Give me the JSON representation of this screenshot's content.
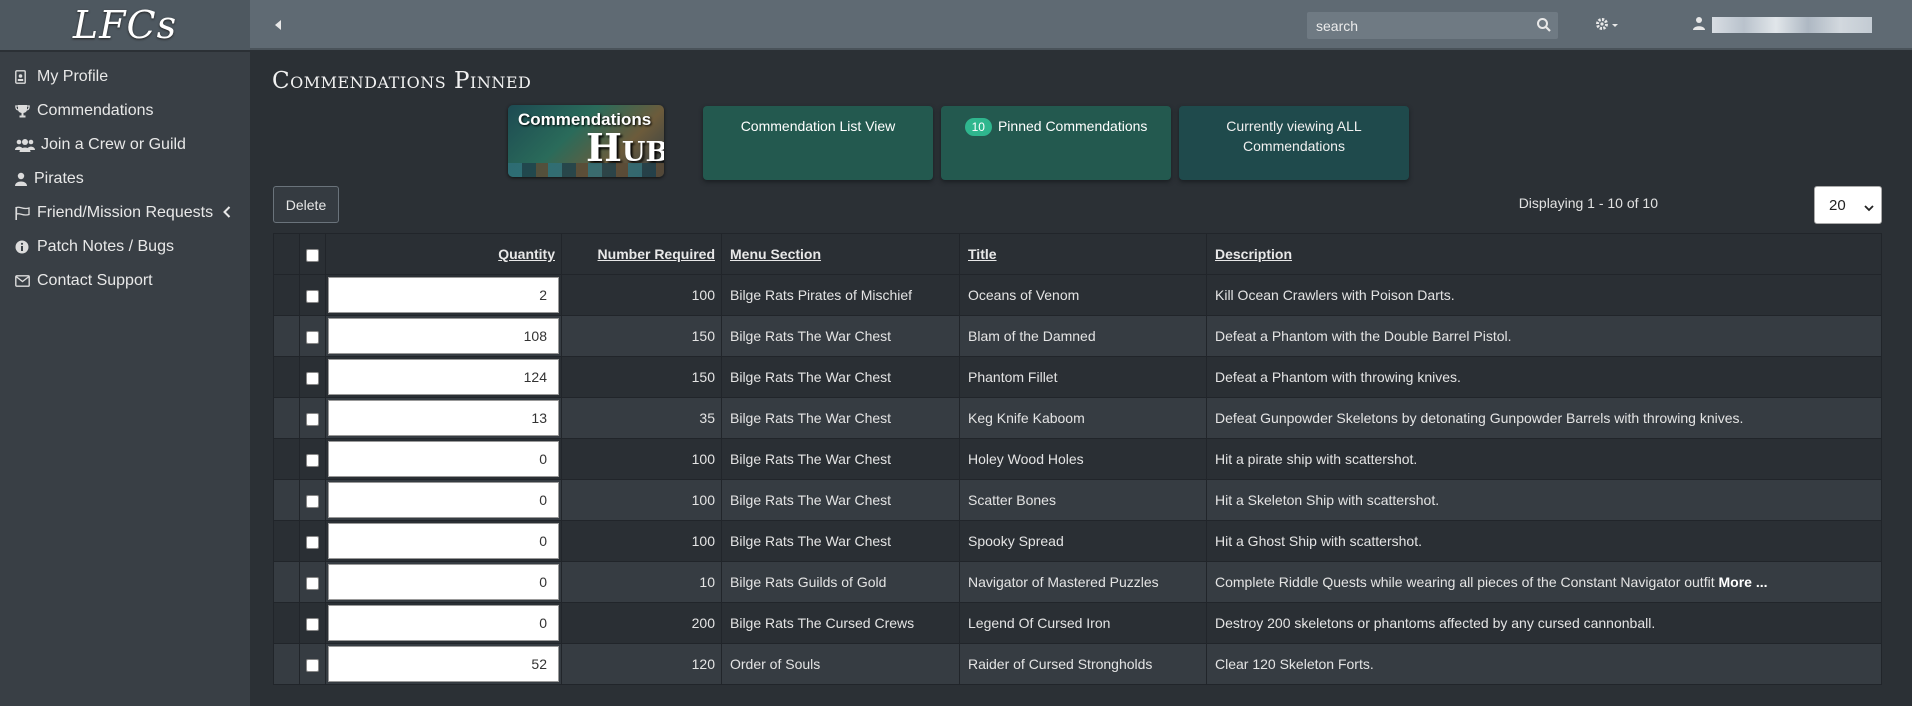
{
  "brand": {
    "logo": "LFCs"
  },
  "topbar": {
    "search_placeholder": "search",
    "collapse_icon": "chevron-left-icon",
    "search_icon": "search-icon",
    "settings_icon": "gear-icon",
    "user_icon": "user-icon"
  },
  "sidebar": {
    "items": [
      {
        "label": "My Profile",
        "icon": "id-badge-icon"
      },
      {
        "label": "Commendations",
        "icon": "trophy-icon"
      },
      {
        "label": "Join a Crew or Guild",
        "icon": "users-icon"
      },
      {
        "label": "Pirates",
        "icon": "user-icon"
      },
      {
        "label": "Friend/Mission Requests",
        "icon": "flag-icon"
      },
      {
        "label": "Patch Notes / Bugs",
        "icon": "info-circle-icon"
      },
      {
        "label": "Contact Support",
        "icon": "envelope-icon"
      }
    ]
  },
  "main": {
    "title": "Commendations Pinned",
    "hub": {
      "top": "Commendations",
      "big": "Hub"
    },
    "tiles": {
      "list_view": "Commendation List View",
      "pinned_count": "10",
      "pinned_label": "Pinned Commendations",
      "viewing_line1": "Currently viewing ALL",
      "viewing_line2": "Commendations"
    },
    "delete_label": "Delete",
    "displaying": "Displaying 1 - 10 of 10",
    "page_size": "20"
  },
  "table": {
    "headers": {
      "quantity": "Quantity",
      "required": "Number Required",
      "section": "Menu Section",
      "title": "Title",
      "description": "Description"
    },
    "more_label": "More ...",
    "rows": [
      {
        "qty": "2",
        "req": "100",
        "section": "Bilge Rats Pirates of Mischief",
        "title": "Oceans of Venom",
        "desc": "Kill Ocean Crawlers with Poison Darts."
      },
      {
        "qty": "108",
        "req": "150",
        "section": "Bilge Rats The War Chest",
        "title": "Blam of the Damned",
        "desc": "Defeat a Phantom with the Double Barrel Pistol."
      },
      {
        "qty": "124",
        "req": "150",
        "section": "Bilge Rats The War Chest",
        "title": "Phantom Fillet",
        "desc": "Defeat a Phantom with throwing knives."
      },
      {
        "qty": "13",
        "req": "35",
        "section": "Bilge Rats The War Chest",
        "title": "Keg Knife Kaboom",
        "desc": "Defeat Gunpowder Skeletons by detonating Gunpowder Barrels with throwing knives."
      },
      {
        "qty": "0",
        "req": "100",
        "section": "Bilge Rats The War Chest",
        "title": "Holey Wood Holes",
        "desc": "Hit a pirate ship with scattershot."
      },
      {
        "qty": "0",
        "req": "100",
        "section": "Bilge Rats The War Chest",
        "title": "Scatter Bones",
        "desc": "Hit a Skeleton Ship with scattershot."
      },
      {
        "qty": "0",
        "req": "100",
        "section": "Bilge Rats The War Chest",
        "title": "Spooky Spread",
        "desc": "Hit a Ghost Ship with scattershot."
      },
      {
        "qty": "0",
        "req": "10",
        "section": "Bilge Rats Guilds of Gold",
        "title": "Navigator of Mastered Puzzles",
        "desc": "Complete Riddle Quests while wearing all pieces of the Constant Navigator outfit"
      },
      {
        "qty": "0",
        "req": "200",
        "section": "Bilge Rats The Cursed Crews",
        "title": "Legend Of Cursed Iron",
        "desc": "Destroy 200 skeletons or phantoms affected by any cursed cannonball."
      },
      {
        "qty": "52",
        "req": "120",
        "section": "Order of Souls",
        "title": "Raider of Cursed Strongholds",
        "desc": "Clear 120 Skeleton Forts."
      }
    ]
  }
}
